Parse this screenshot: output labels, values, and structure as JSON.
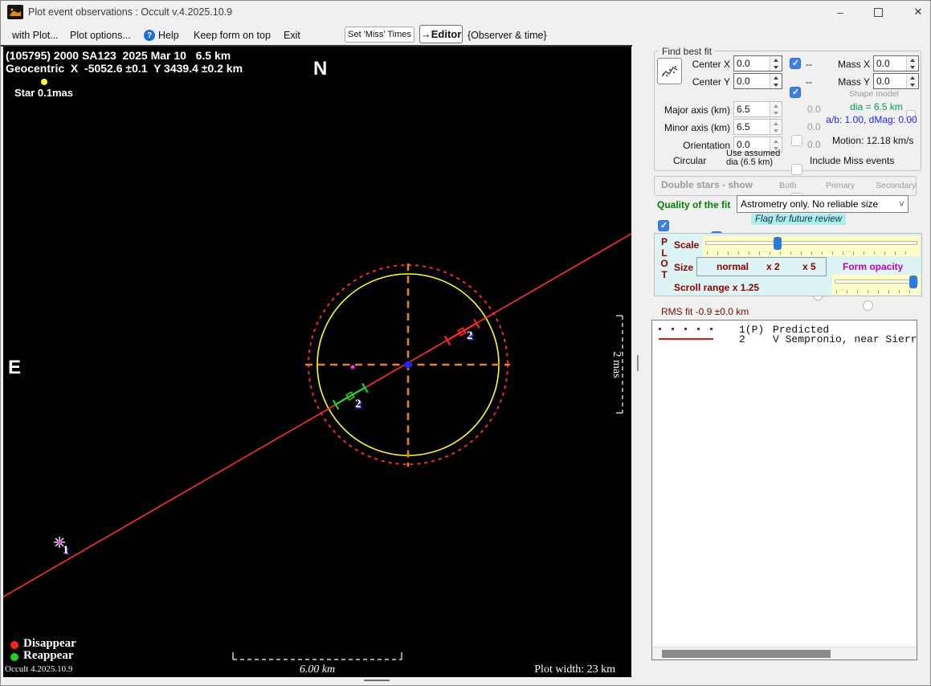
{
  "window": {
    "title": "Plot event observations : Occult v.4.2025.10.9",
    "controls": {
      "minimize": "–",
      "close": "✕"
    }
  },
  "menubar": {
    "with_plot": "with Plot...",
    "plot_options": "Plot options...",
    "help": "Help",
    "keep_on_top": "Keep form on top",
    "exit": "Exit",
    "set_miss_times": "Set 'Miss' Times",
    "editor": "→Editor",
    "observer_time": "{Observer & time}"
  },
  "plot": {
    "header_line1": "(105795) 2000 SA123  2025 Mar 10   6.5 km",
    "header_line2": "Geocentric  X  -5052.6 ±0.1  Y 3439.4 ±0.2 km",
    "star_label": "Star 0.1mas",
    "north_label": "N",
    "east_label": "E",
    "predicted_marker_label": "1",
    "disappear_marker_label": "2",
    "reappear_marker_label": "2",
    "scale_bar_label": "6.00 km",
    "angular_bar_label": "2 mas",
    "legend_disappear": "Disappear",
    "legend_reappear": "Reappear",
    "version_label": "Occult 4.2025.10.9",
    "plot_width_label": "Plot width: 23 km"
  },
  "find_best_fit": {
    "label": "Find best fit",
    "center_x": {
      "label": "Center X",
      "value": "0.0",
      "fit_flag": "--"
    },
    "center_y": {
      "label": "Center Y",
      "value": "0.0",
      "fit_flag": "--"
    },
    "mass_x": {
      "label": "Mass X",
      "value": "0.0"
    },
    "mass_y": {
      "label": "Mass Y",
      "value": "0.0"
    },
    "shape_model": "Shape model",
    "major_axis": {
      "label": "Major axis (km)",
      "value": "6.5",
      "err": "0.0"
    },
    "minor_axis": {
      "label": "Minor axis (km)",
      "value": "6.5",
      "err": "0.0"
    },
    "orientation": {
      "label": "Orientation",
      "value": "0.0",
      "err": "0.0"
    },
    "dia_text": "dia = 6.5 km",
    "ab_text": "a/b: 1.00, dMag: 0.00",
    "motion_text": "Motion: 12.18 km/s",
    "circular": "Circular",
    "use_assumed_line1": "Use assumed",
    "use_assumed_line2": "dia (6.5 km)",
    "include_miss": "Include Miss events"
  },
  "double_stars": {
    "label": "Double stars - show",
    "options": [
      {
        "label": "Both"
      },
      {
        "label": "Primary"
      },
      {
        "label": "Secondary"
      }
    ],
    "selected": "Both"
  },
  "quality": {
    "label": "Quality of the fit",
    "value": "Astrometry only. No reliable size",
    "flag_label": "Flag for future review"
  },
  "plot_controls": {
    "letters": [
      "P",
      "L",
      "O",
      "T"
    ],
    "scale_label": "Scale",
    "size_label": "Size",
    "size_options": [
      {
        "label": "normal"
      },
      {
        "label": "x 2"
      },
      {
        "label": "x 5"
      }
    ],
    "size_selected": "normal",
    "form_opacity_label": "Form opacity",
    "scroll_range_label": "Scroll range x 1.25",
    "scale_percent": 33,
    "opacity_percent": 93
  },
  "rms_text": "RMS fit -0.9 ±0.0 km",
  "chord_list": {
    "rows": [
      {
        "id": "1(P)",
        "name": "Predicted",
        "line_style": "dotted"
      },
      {
        "id": "2",
        "name": "V Sempronio, near Sierr",
        "line_style": "solid"
      }
    ]
  },
  "colors": {
    "accent_blue": "#3d7fe4",
    "maroon": "#8b0000",
    "magenta": "#bd00bd",
    "quality_green": "#008000",
    "dia_green": "#00a050",
    "ab_blue": "#2222ff",
    "panel_cyan": "#ddf4f4",
    "flag_highlight": "#afeeee",
    "plot_yellow": "#ffff2e",
    "plot_red": "#ff3030",
    "plot_orange": "#e8821e",
    "plot_green": "#22d422"
  }
}
